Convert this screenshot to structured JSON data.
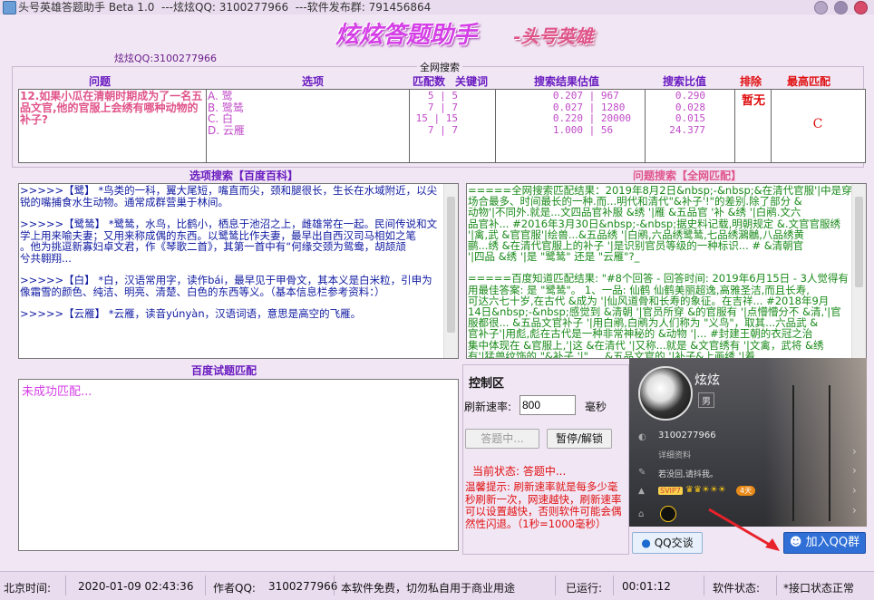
{
  "window": {
    "title": "头号英雄答题助手 Beta 1.0  ---炫炫QQ: 3100277966  ---软件发布群: 791456864"
  },
  "banner": {
    "main": "炫炫答题助手",
    "sub": "-头号英雄"
  },
  "qq_line": "炫炫QQ:3100277966",
  "answer_table": {
    "group_title": "全网搜索",
    "headers": [
      "问题",
      "选项",
      "匹配数",
      "关键词",
      "搜索结果估值",
      "搜索比值",
      "排除",
      "最高匹配"
    ],
    "question": "12.如果小瓜在清朝时期成为了一名五品文官,他的官服上会绣有哪种动物的补子?",
    "options": [
      "A. 鹭",
      "B. 鹭鸶",
      "C. 白",
      "D. 云雁"
    ],
    "match": [
      "5",
      "7",
      "15",
      "7"
    ],
    "keyword": [
      "5",
      "7",
      "15",
      "7"
    ],
    "est_a": [
      "0.207",
      "0.027",
      "0.220",
      "1.000"
    ],
    "est_b": [
      "967",
      "1280",
      "20000",
      "56"
    ],
    "ratio": [
      "0.290",
      "0.028",
      "0.015",
      "24.377"
    ],
    "exclude": "暂无",
    "best": "C"
  },
  "baike": {
    "title": "选项搜索【百度百科】",
    "lines": [
      ">>>>>【鹭】 *鸟类的一科，翼大尾短，嘴直而尖，颈和腿很长，生长在水域附近，以尖",
      "锐的嘴捕食水生动物。通常成群营巢于林间。",
      "",
      ">>>>>【鹭鸶】 *鹭鸶，水鸟，比鹤小，栖息于池沼之上，雌雄常在一起。民间传说和文",
      "学上用来喻夫妻；又用来称成偶的东西。以鹭鸶比作夫妻，最早出自西汉司马相如之笔",
      "。他为挑逗新寡妇卓文君，作《琴歌二首》，其第一首中有“何缘交颈为鸳鸯，胡颉颃",
      "兮共翱翔...",
      "",
      ">>>>>【白】 *白，汉语常用字，读作bái，最早见于甲骨文，其本义是白米粒，引申为",
      "像霜雪的颜色、纯洁、明亮、清楚、白色的东西等义。（基本信息栏参考资料：）",
      "",
      ">>>>>【云雁】 *云雁，读音yúnyàn，汉语词语，意思是高空的飞雁。"
    ]
  },
  "web_search": {
    "title": "问题搜索【全网匹配】",
    "lines": [
      "=====全网搜索匹配结果：2019年8月2日&nbsp;-&nbsp;&在清代官服'|中是穿用",
      "场合最多、时间最长的一种.而...明代和清代\"&补子'!\"的差别.除了部分 &",
      "动物'|不同外.就是...文四品官补服 &绣 '|雁 &五品官 '补 &绣 '|白鹇.文六",
      "品官补...  #2016年3月30日&nbsp;-&nbsp;据史料记载,明朝规定 &.文官官服绣",
      "'|禽,武 &官官服'|绘兽...&五品绣 '|白鹇,六品绣鹭鸶,七品绣鸂鶒,八品绣黄",
      "鹂...绣 &在清代官服上的补子 '|是识别官员等级的一种标识...  # &清朝官",
      "'|四品 &绣 '|是 \"鹭鸶\" 还是 \"云雁\"?_",
      "",
      "=====百度知道匹配结果: \"#8个回答 - 回答时间: 2019年6月15日 - 3人觉得有",
      "用最佳答案: 是 \"鹭鸶\"。 1、一品: 仙鹤 仙鹤美丽超逸,高雅圣洁,而且长寿,",
      "可达六七十岁,在古代 &成为 '|仙风道骨和长寿的象征。在吉祥... #2018年9月",
      "14日&nbsp;-&nbsp;感觉到 &清朝 '|官员所穿 &的官服有 '|点懵懵分不 &清,'|官",
      "服都很...  &五品文官补子 '|用白鹇,白鹇为人们称为 \"义鸟\"，取其...六品武 &",
      "官补子'|用彪,彪在古代是一种非常神秘的 &动物 '|...  #封建王朝的衣冠之治",
      "集中体现在 &官服上,'|这 &在清代 '|又称...就是 &文官绣有 '|文禽，武将 &绣",
      "有'|猛兽纹饰的 \"&补子 '|\" ... &五品文官的 '|补子&上画绣 '|着"
    ]
  },
  "trial_match": {
    "title": "百度试题匹配",
    "content": "未成功匹配..."
  },
  "control": {
    "title": "控制区",
    "refresh_label": "刷新速率:",
    "refresh_value": "800",
    "unit": "毫秒",
    "answering_btn": "答题中...",
    "pause_btn": "暂停/解锁",
    "state_label": "当前状态: 答题中...",
    "tip": "温馨提示: 刷新速率就是每多少毫秒刷新一次，网速越快，刷新速率可以设置越快，否则软件可能会偶然性闪退。（1秒=1000毫秒）"
  },
  "profile": {
    "name": "炫炫",
    "gender": "男",
    "qq": "3100277966",
    "detail_link": "详细资料",
    "signature": "若没回,请抖我。",
    "level_badge": "4天",
    "svip": "SVIP7",
    "qq_chat_btn": "QQ交谈",
    "join_group_btn": "加入QQ群"
  },
  "status_bar": {
    "time_label": "北京时间:",
    "time_value": "2020-01-09 02:43:36",
    "author_label": "作者QQ:",
    "author_value": "3100277966",
    "notice": "本软件免费，切勿私自用于商业用途",
    "runtime_label": "已运行:",
    "runtime_value": "00:01:12",
    "state_label": "软件状态:",
    "state_value": "*接口状态正常"
  },
  "colors": {
    "accent_purple": "#6a1cc0",
    "question_pink": "#e0548a",
    "banner_magenta": "#d43fe6",
    "red": "#e01010",
    "green": "#1a8a1a"
  }
}
